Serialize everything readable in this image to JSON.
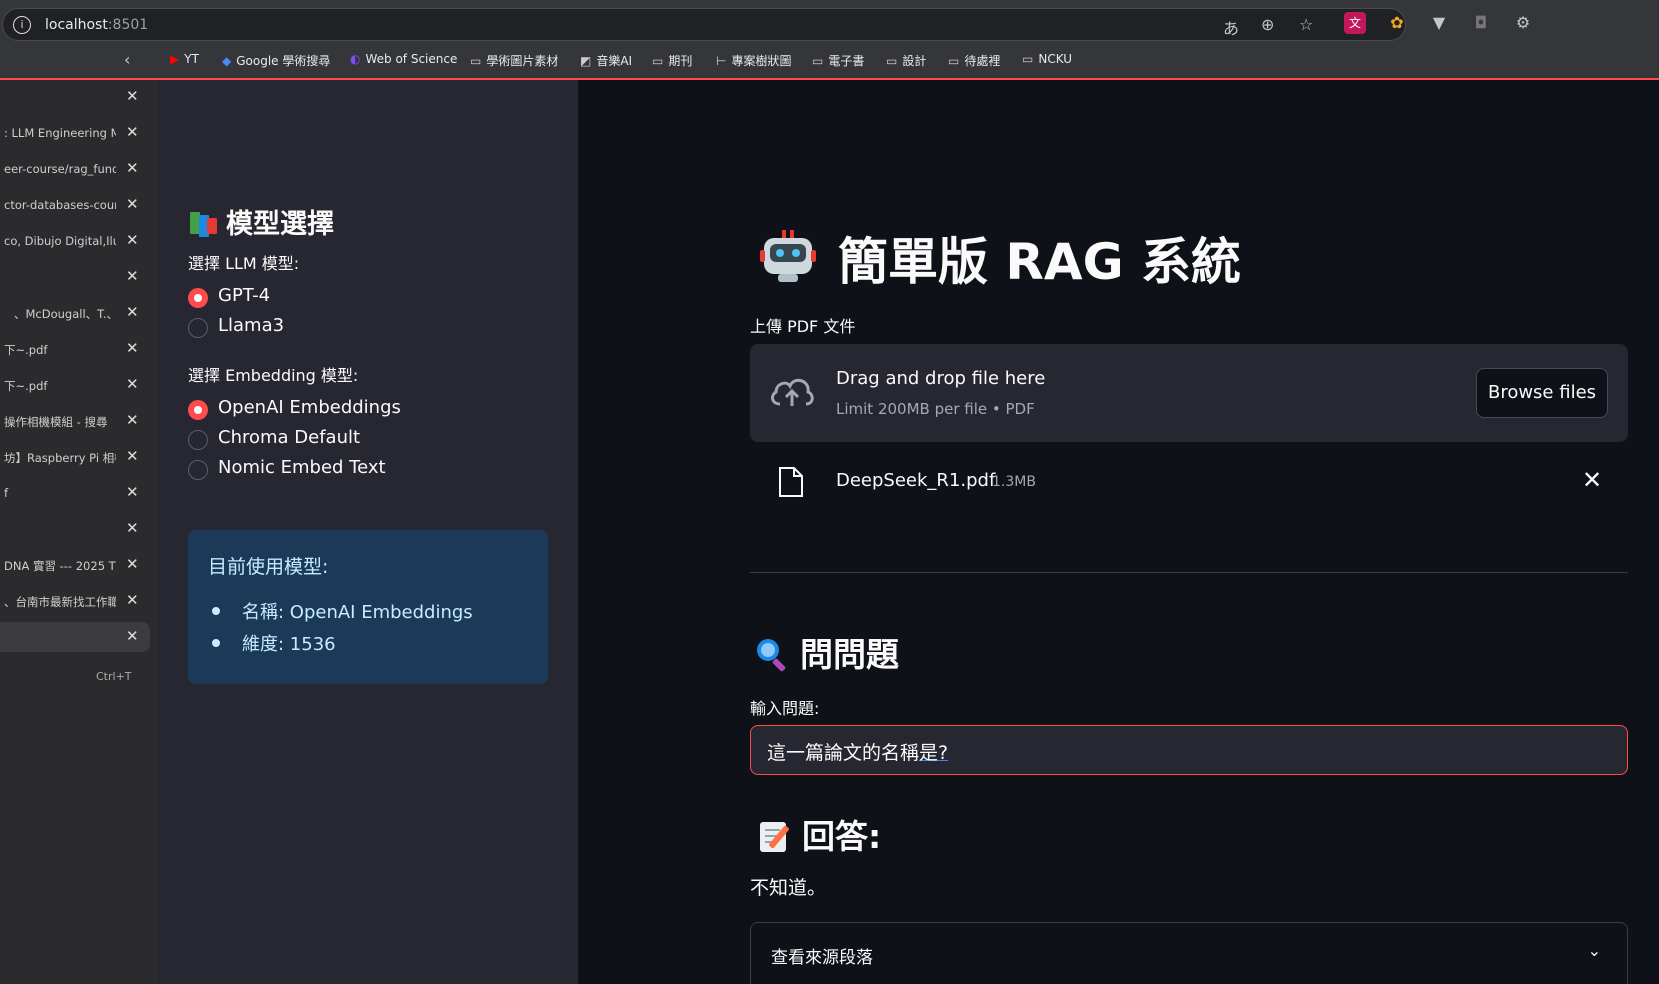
{
  "browser": {
    "address": "localhost",
    "port": ":8501",
    "bookmarks": [
      "YT",
      "Google 學術搜尋",
      "Web of Science",
      "學術圖片素材",
      "音樂AI",
      "期刊",
      "專案樹狀圖",
      "電子書",
      "設計",
      "待處裡",
      "NCKU"
    ],
    "tabs": [
      "",
      ": LLM Engineering Ma",
      "eer-course/rag_funda",
      "ctor-databases-cours",
      "co, Dibujo Digital,Ilust",
      "",
      "、McDougall、T.、",
      "下~.pdf",
      "下~.pdf",
      "操作相機模組 - 搜尋",
      "坊】Raspberry Pi 相機",
      "f",
      "",
      "DNA 實習 --- 2025 T",
      "、台南市最新找工作職",
      ""
    ],
    "new_tab_shortcut": "Ctrl+T"
  },
  "sidebar": {
    "heading": "模型選擇",
    "llm_label": "選擇 LLM 模型:",
    "llm_options": [
      "GPT-4",
      "Llama3"
    ],
    "llm_selected": "GPT-4",
    "embed_label": "選擇 Embedding 模型:",
    "embed_options": [
      "OpenAI Embeddings",
      "Chroma Default",
      "Nomic Embed Text"
    ],
    "embed_selected": "OpenAI Embeddings",
    "info_title": "目前使用模型:",
    "info_items": [
      "名稱: OpenAI Embeddings",
      "維度: 1536"
    ]
  },
  "main": {
    "title": "簡單版 RAG 系統",
    "upload_label": "上傳 PDF 文件",
    "dropzone_text": "Drag and drop file here",
    "dropzone_limit": "Limit 200MB per file • PDF",
    "browse_label": "Browse files",
    "file_name": "DeepSeek_R1.pdf",
    "file_size": "1.3MB",
    "ask_heading": "問問題",
    "question_label": "輸入問題:",
    "question_value_a": "這一篇論文的名稱",
    "question_value_b": "是?",
    "answer_heading": "回答:",
    "answer_text": "不知道。",
    "expander_label": "查看來源段落"
  },
  "colors": {
    "accent": "#ff4b4b",
    "sidebar_bg": "#262730",
    "main_bg": "#0e1117",
    "info_bg": "#1c3a57"
  }
}
